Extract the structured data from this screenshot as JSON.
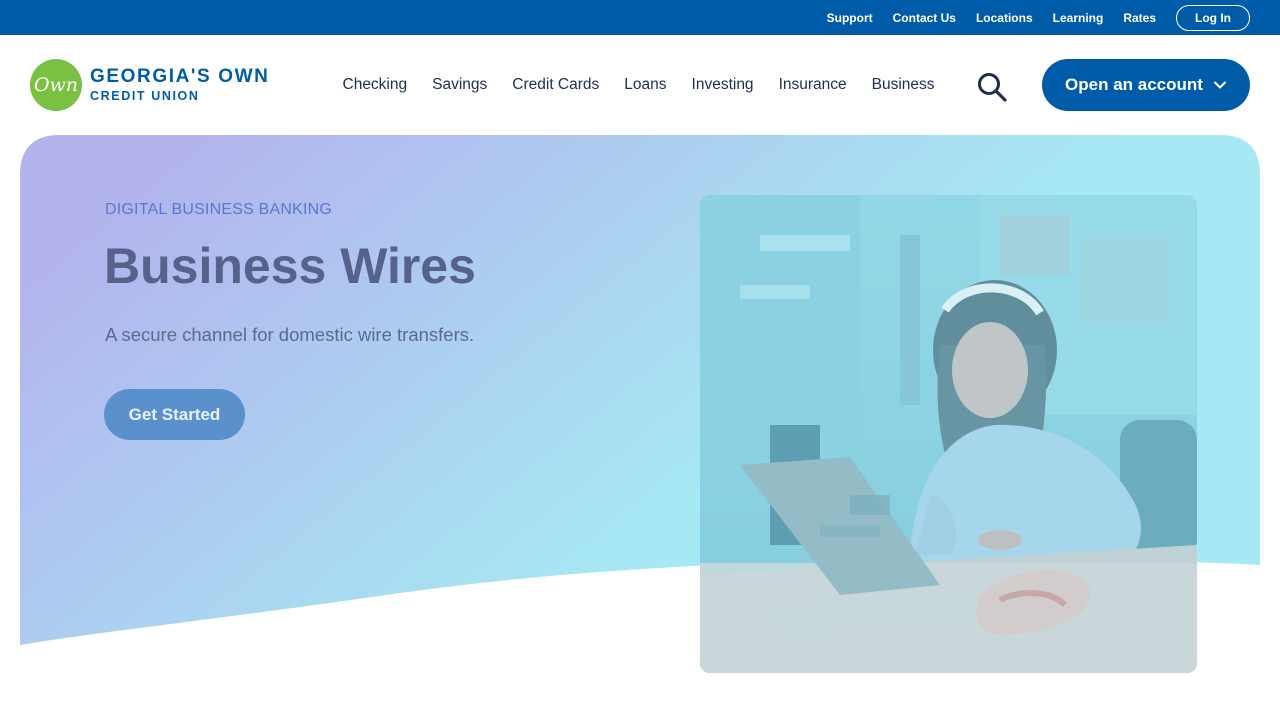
{
  "utility_nav": {
    "links": [
      "Support",
      "Contact Us",
      "Locations",
      "Learning",
      "Rates"
    ],
    "login_label": "Log In"
  },
  "brand": {
    "mark_text": "Own",
    "name_line1": "GEORGIA'S OWN",
    "name_line2": "CREDIT UNION"
  },
  "main_nav": {
    "items": [
      "Checking",
      "Savings",
      "Credit Cards",
      "Loans",
      "Investing",
      "Insurance",
      "Business"
    ],
    "search_icon": "search-icon",
    "cta_label": "Open an account",
    "cta_icon": "chevron-down-icon"
  },
  "hero": {
    "eyebrow": "DIGITAL BUSINESS BANKING",
    "title": "Business Wires",
    "subtitle": "A secure channel for domestic wire transfers.",
    "cta_label": "Get Started"
  },
  "colors": {
    "brand_blue": "#005ca9",
    "brand_green": "#7ac143",
    "hero_gradient_start": "#b3b4ee",
    "hero_gradient_end": "#a6e8f3",
    "cta_secondary": "#5a90cc"
  }
}
